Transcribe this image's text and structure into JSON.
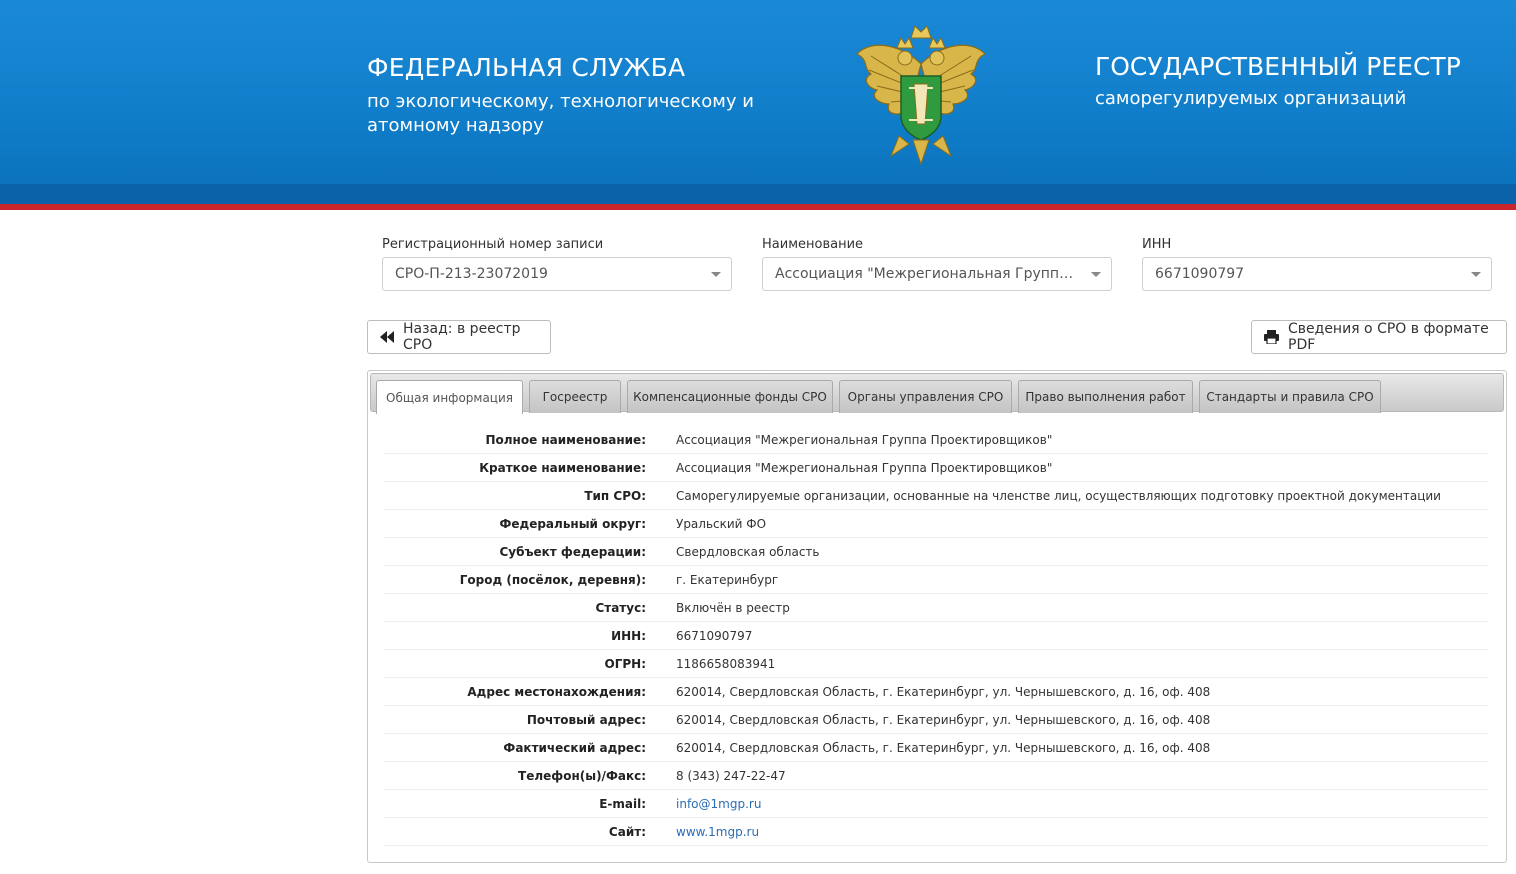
{
  "header": {
    "left_title": "ФЕДЕРАЛЬНАЯ СЛУЖБА",
    "left_subtitle": "по экологическому, технологическому и атомному надзору",
    "right_title": "ГОСУДАРСТВЕННЫЙ РЕЕСТР",
    "right_subtitle": "саморегулируемых организаций",
    "emblem_icon": "double-headed-eagle-emblem"
  },
  "filters": {
    "reg_number": {
      "label": "Регистрационный номер записи",
      "value": "СРО-П-213-23072019"
    },
    "name": {
      "label": "Наименование",
      "value": "Ассоциация \"Межрегиональная Группа Проектировщиков\""
    },
    "inn": {
      "label": "ИНН",
      "value": "6671090797"
    }
  },
  "actions": {
    "back_label": "Назад: в реестр СРО",
    "pdf_label": "Сведения о СРО в формате PDF"
  },
  "tabs": [
    {
      "label": "Общая информация",
      "active": true
    },
    {
      "label": "Госреестр"
    },
    {
      "label": "Компенсационные фонды СРО"
    },
    {
      "label": "Органы управления СРО"
    },
    {
      "label": "Право выполнения работ"
    },
    {
      "label": "Стандарты и правила СРО"
    }
  ],
  "info": [
    {
      "key": "Полное наименование:",
      "value": "Ассоциация \"Межрегиональная Группа Проектировщиков\""
    },
    {
      "key": "Краткое наименование:",
      "value": "Ассоциация \"Межрегиональная Группа Проектировщиков\""
    },
    {
      "key": "Тип СРО:",
      "value": "Саморегулируемые организации, основанные на членстве лиц, осуществляющих подготовку проектной документации"
    },
    {
      "key": "Федеральный округ:",
      "value": "Уральский ФО"
    },
    {
      "key": "Субъект федерации:",
      "value": "Свердловская область"
    },
    {
      "key": "Город (посёлок, деревня):",
      "value": "г. Екатеринбург"
    },
    {
      "key": "Статус:",
      "value": "Включён в реестр"
    },
    {
      "key": "ИНН:",
      "value": "6671090797"
    },
    {
      "key": "ОГРН:",
      "value": "1186658083941"
    },
    {
      "key": "Адрес местонахождения:",
      "value": "620014, Свердловская Область, г. Екатеринбург, ул. Чернышевского, д. 16, оф. 408"
    },
    {
      "key": "Почтовый адрес:",
      "value": "620014, Свердловская Область, г. Екатеринбург, ул. Чернышевского, д. 16, оф. 408"
    },
    {
      "key": "Фактический адрес:",
      "value": "620014, Свердловская Область, г. Екатеринбург, ул. Чернышевского, д. 16, оф. 408"
    },
    {
      "key": "Телефон(ы)/Факс:",
      "value": "8 (343) 247-22-47"
    },
    {
      "key": "E-mail:",
      "value": "info@1mgp.ru",
      "link": true
    },
    {
      "key": "Сайт:",
      "value": "www.1mgp.ru",
      "link": true
    }
  ],
  "colors": {
    "header_blue": "#0f7cc8",
    "accent_red": "#c8262c",
    "link": "#2a6db3"
  }
}
